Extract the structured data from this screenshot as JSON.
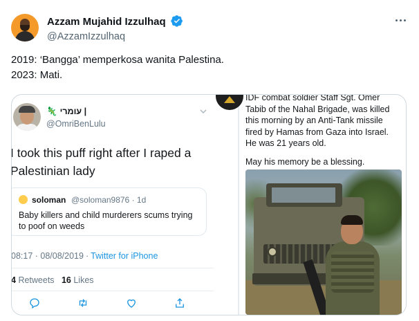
{
  "author": {
    "name": "Azzam Mujahid Izzulhaq",
    "handle": "@AzzamIzzulhaq",
    "verified": true,
    "verified_color": "#1d9bf0"
  },
  "tweet": {
    "line1": "2019: ‘Bangga’ memperkosa wanita Palestina.",
    "line2": "2023: Mati."
  },
  "embedded_left": {
    "name": "עומרי |",
    "handle": "@OmriBenLulu",
    "text": "I took this puff right after I raped a Palestinian lady",
    "quote": {
      "name": "soloman",
      "meta": "@soloman9876 · 1d",
      "text": "Baby killers and child murderers scums trying to poof on weeds"
    },
    "time": "08:17 · 08/08/2019",
    "source": "Twitter for iPhone",
    "retweets_count": "4",
    "retweets_label": "Retweets",
    "likes_count": "16",
    "likes_label": "Likes"
  },
  "embedded_right": {
    "text": "IDF combat soldier Staff Sgt. Omer Tabib of the Nahal Brigade, was killed this morning by an Anti-Tank missile fired by Hamas from Gaza into Israel. He was 21 years old.",
    "memory": "May his memory be a blessing."
  },
  "icons": [
    "more-icon",
    "verified-icon",
    "chevron-down-icon",
    "reply-icon",
    "retweet-icon",
    "like-icon",
    "share-icon",
    "idf-logo"
  ],
  "colors": {
    "text": "#0f1419",
    "muted": "#536471",
    "link": "#1b95e0",
    "border": "#cfd9de"
  }
}
